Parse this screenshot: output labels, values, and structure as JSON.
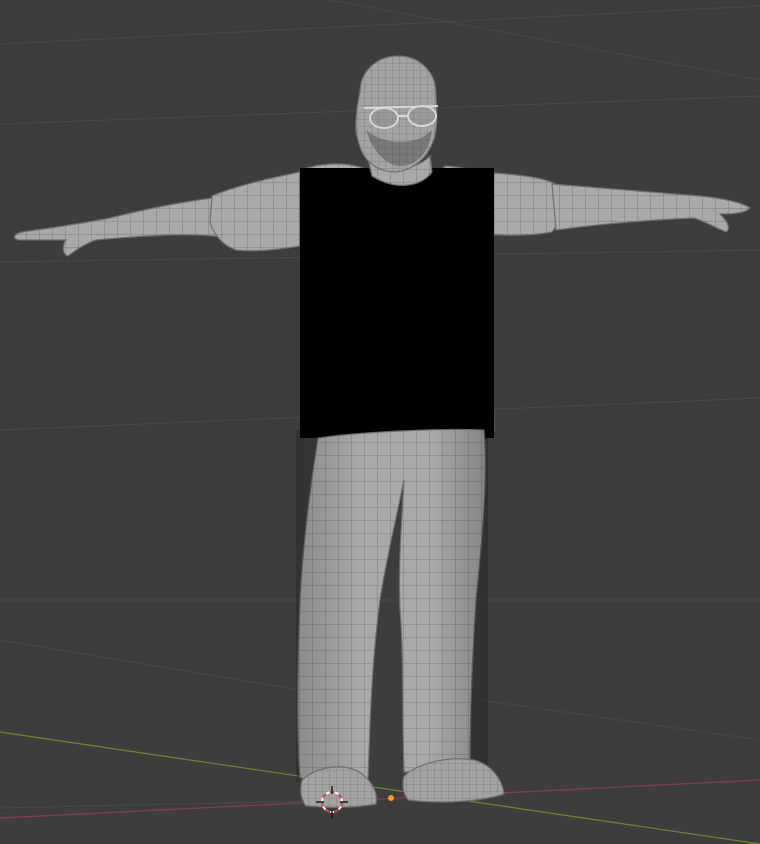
{
  "viewport": {
    "background_color": "#3d3d3d",
    "grid_color": "#4a4a4a",
    "x_axis_color": "#8c3e48",
    "y_axis_color": "#6b8a2c",
    "mesh_color": "#a9a9a9",
    "wire_color": "#6d6d6d",
    "cursor_icon": "3d-cursor-icon",
    "origin_color": "#f0a030"
  }
}
